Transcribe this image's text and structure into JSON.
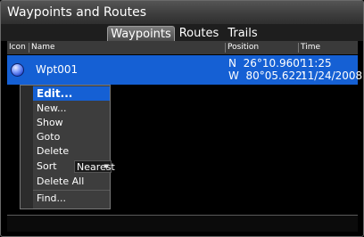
{
  "window": {
    "title": "Waypoints and Routes"
  },
  "tabs": [
    {
      "label": "Waypoints",
      "active": true
    },
    {
      "label": "Routes",
      "active": false
    },
    {
      "label": "Trails",
      "active": false
    }
  ],
  "table": {
    "columns": {
      "icon": "Icon",
      "name": "Name",
      "position": "Position",
      "time": "Time"
    },
    "rows": [
      {
        "icon": "waypoint-ball-icon",
        "name": "Wpt001",
        "lat": "N  26°10.960'",
        "lon": "W  80°05.622'",
        "time": "11:25",
        "date": "11/24/2008",
        "selected": true
      }
    ]
  },
  "context_menu": {
    "items": {
      "edit": "Edit...",
      "new": "New...",
      "show": "Show",
      "goto": "Goto",
      "delete": "Delete",
      "sort_label": "Sort",
      "sort_value": "Nearest",
      "delete_all": "Delete All",
      "find": "Find..."
    },
    "selected_item": "edit"
  },
  "colors": {
    "selection": "#1560d4",
    "background": "#000000",
    "menu": "#3d3d3d"
  }
}
